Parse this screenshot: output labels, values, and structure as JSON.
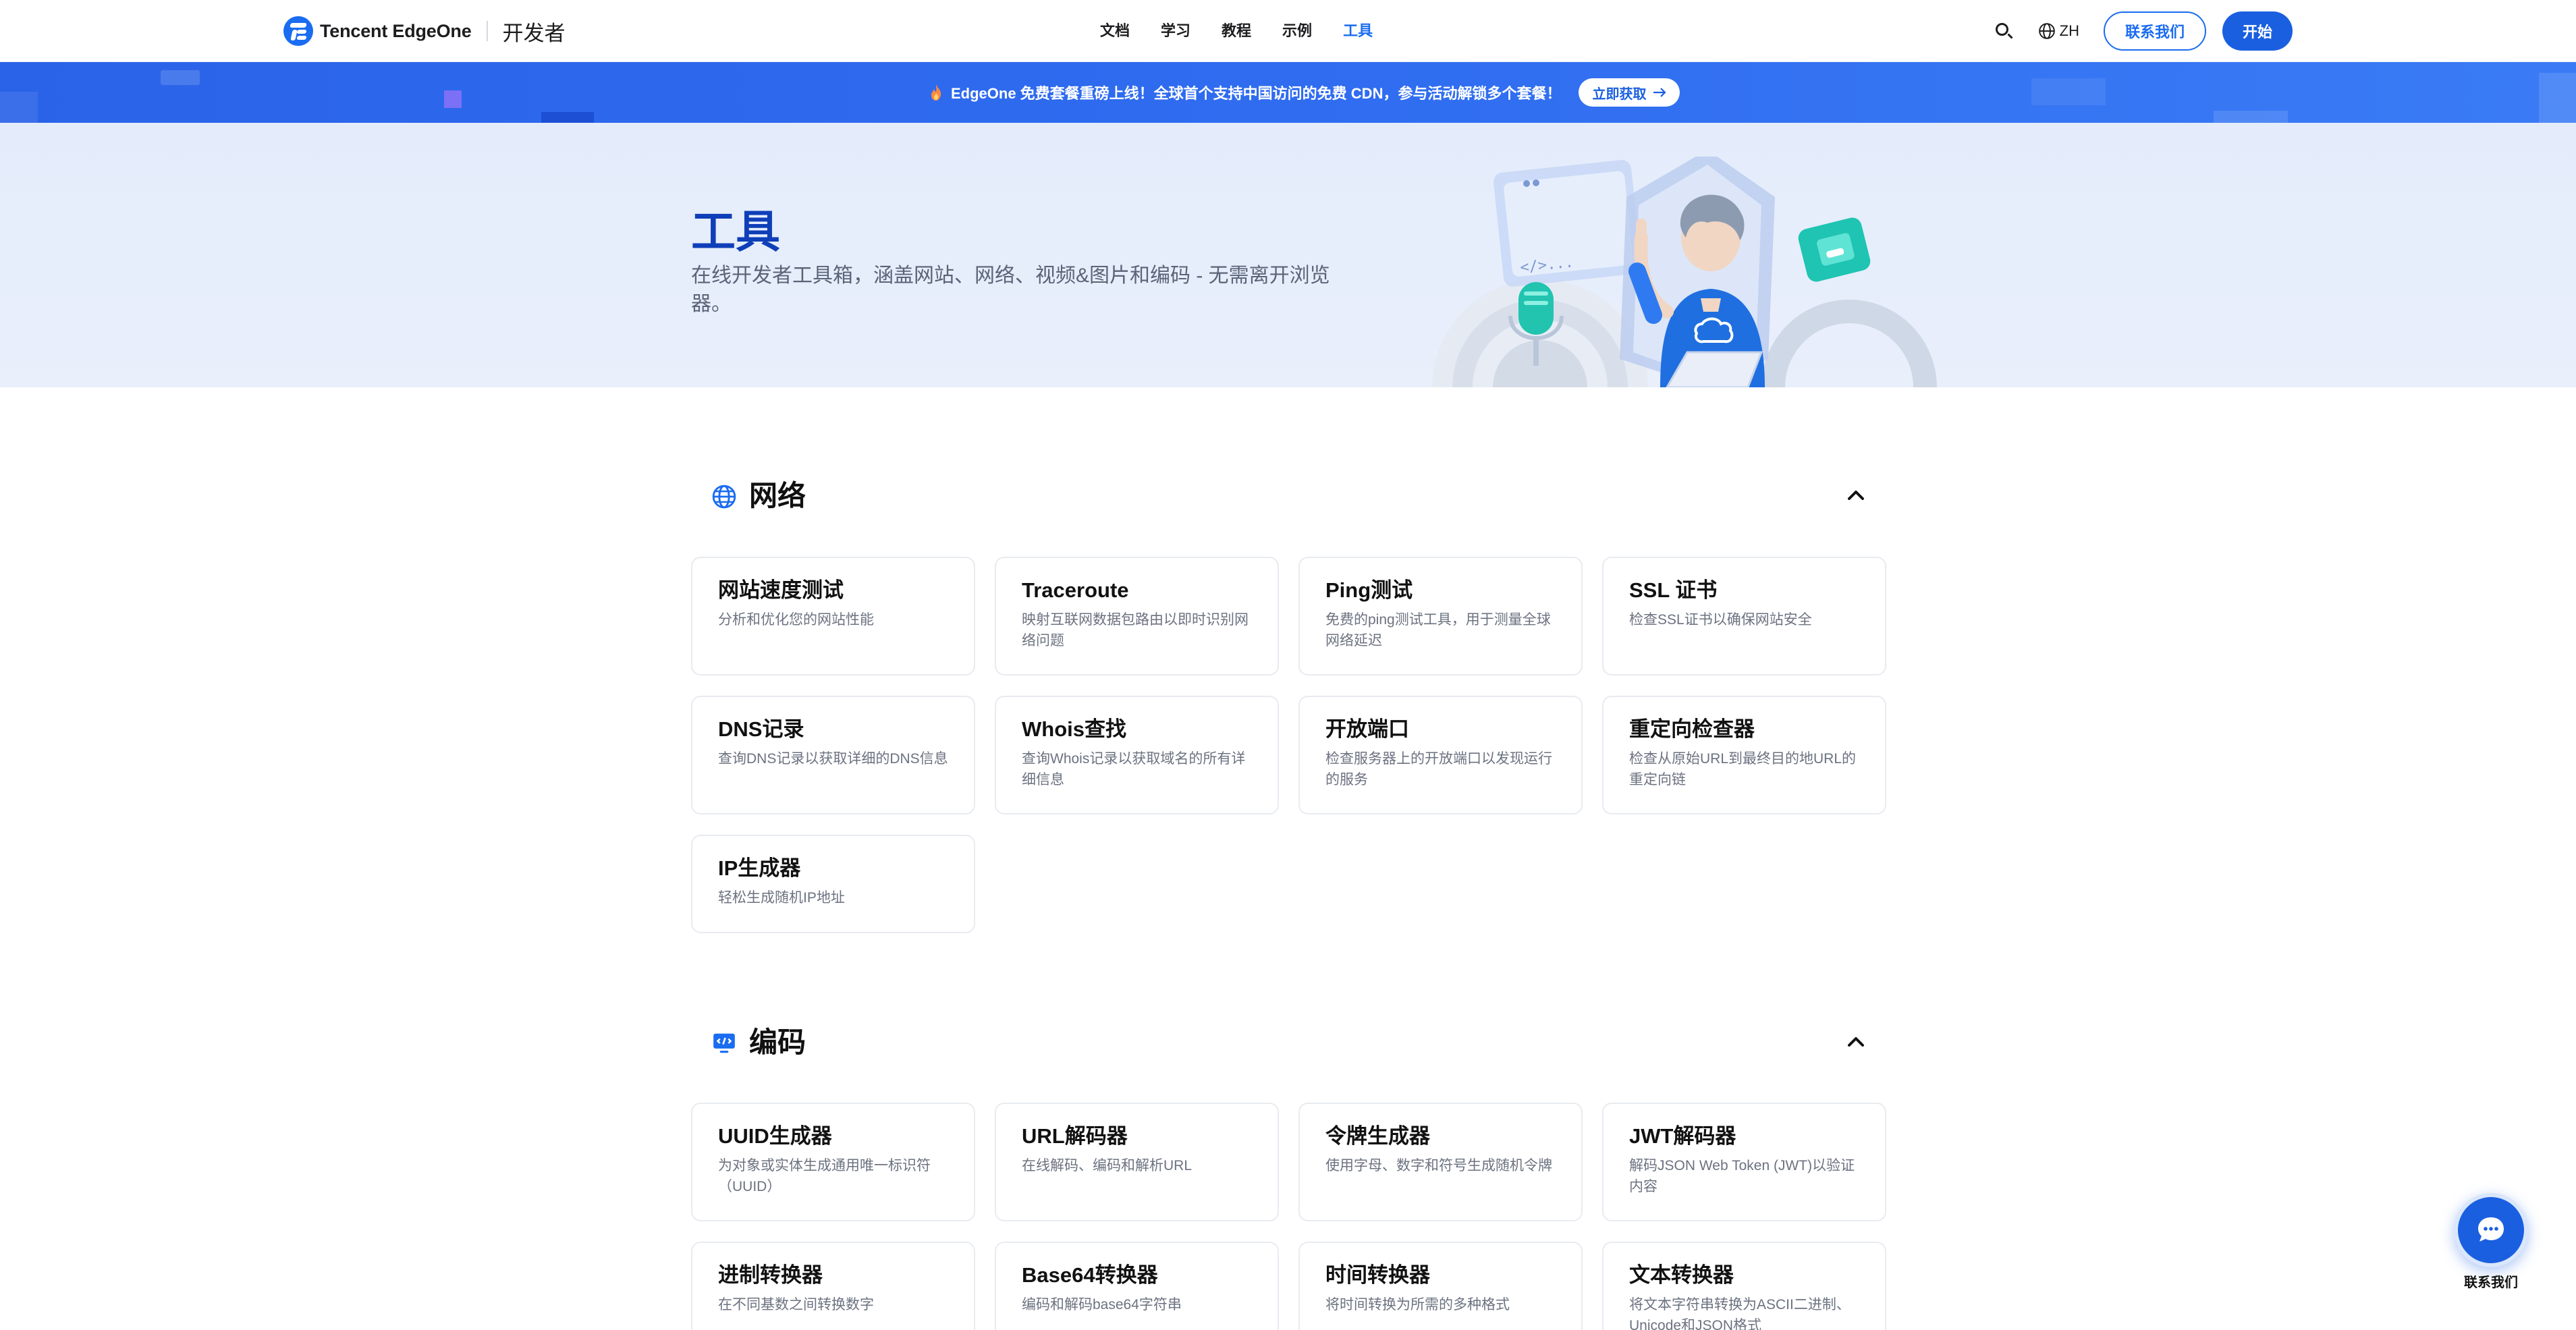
{
  "brand": {
    "name": "Tencent EdgeOne",
    "section": "开发者"
  },
  "nav": {
    "links": [
      {
        "label": "文档",
        "active": false
      },
      {
        "label": "学习",
        "active": false
      },
      {
        "label": "教程",
        "active": false
      },
      {
        "label": "示例",
        "active": false
      },
      {
        "label": "工具",
        "active": true
      }
    ],
    "lang": "ZH",
    "contact_label": "联系我们",
    "start_label": "开始"
  },
  "promo": {
    "text": "EdgeOne 免费套餐重磅上线！全球首个支持中国访问的免费 CDN，参与活动解锁多个套餐！",
    "button_label": "立即获取"
  },
  "hero": {
    "title": "工具",
    "subtitle": "在线开发者工具箱，涵盖网站、网络、视频&图片和编码 - 无需离开浏览器。",
    "art_code_label": "</>..."
  },
  "sections": [
    {
      "title": "网络",
      "icon": "globe-icon",
      "tools": [
        {
          "title": "网站速度测试",
          "desc": "分析和优化您的网站性能"
        },
        {
          "title": "Traceroute",
          "desc": "映射互联网数据包路由以即时识别网络问题"
        },
        {
          "title": "Ping测试",
          "desc": "免费的ping测试工具，用于测量全球网络延迟"
        },
        {
          "title": "SSL 证书",
          "desc": "检查SSL证书以确保网站安全"
        },
        {
          "title": "DNS记录",
          "desc": "查询DNS记录以获取详细的DNS信息"
        },
        {
          "title": "Whois查找",
          "desc": "查询Whois记录以获取域名的所有详细信息"
        },
        {
          "title": "开放端口",
          "desc": "检查服务器上的开放端口以发现运行的服务"
        },
        {
          "title": "重定向检查器",
          "desc": "检查从原始URL到最终目的地URL的重定向链"
        },
        {
          "title": "IP生成器",
          "desc": "轻松生成随机IP地址"
        }
      ]
    },
    {
      "title": "编码",
      "icon": "code-monitor-icon",
      "tools": [
        {
          "title": "UUID生成器",
          "desc": "为对象或实体生成通用唯一标识符（UUID）"
        },
        {
          "title": "URL解码器",
          "desc": "在线解码、编码和解析URL"
        },
        {
          "title": "令牌生成器",
          "desc": "使用字母、数字和符号生成随机令牌"
        },
        {
          "title": "JWT解码器",
          "desc": "解码JSON Web Token (JWT)以验证内容"
        },
        {
          "title": "进制转换器",
          "desc": "在不同基数之间转换数字"
        },
        {
          "title": "Base64转换器",
          "desc": "编码和解码base64字符串"
        },
        {
          "title": "时间转换器",
          "desc": "将时间转换为所需的多种格式"
        },
        {
          "title": "文本转换器",
          "desc": "将文本字符串转换为ASCII二进制、Unicode和JSON格式"
        }
      ]
    }
  ],
  "float": {
    "label": "联系我们"
  },
  "colors": {
    "primary": "#1a5fe0",
    "accent": "#1a6cf0",
    "hero_title": "#0f3fb8",
    "promo_bg": "#2f6cf0"
  }
}
